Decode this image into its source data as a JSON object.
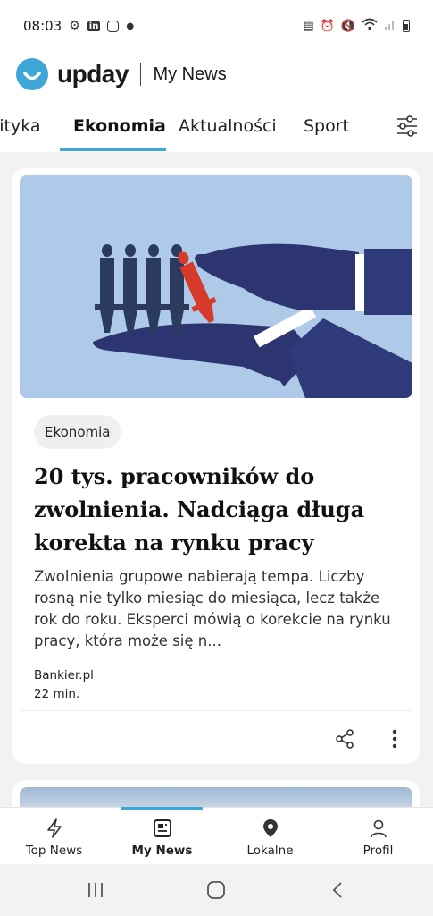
{
  "status_bar": {
    "time": "08:03",
    "left_icons": [
      "usb-icon",
      "linkedin-icon",
      "instagram-icon",
      "dot-icon"
    ],
    "right_icons": [
      "nfc-icon",
      "alarm-icon",
      "mute-icon",
      "wifi-icon",
      "signal-icon",
      "battery-icon"
    ]
  },
  "header": {
    "brand": "upday",
    "section": "My News",
    "accent_color": "#3fa6d8"
  },
  "tabs": {
    "items": [
      {
        "label": "lityka"
      },
      {
        "label": "Ekonomia",
        "active": true
      },
      {
        "label": "Aktualności"
      },
      {
        "label": "Sport"
      }
    ]
  },
  "article": {
    "category": "Ekonomia",
    "title": "20 tys. pracowników do zwolnienia. Nadciąga długa korekta na rynku pracy",
    "excerpt": "Zwolnienia grupowe nabierają tempa. Liczby rosną nie tylko miesiąc do miesiąca, lecz także rok do roku. Eksperci mówią o korekcie na rynku pracy, która może się n...",
    "source": "Bankier.pl",
    "time_ago": "22 min."
  },
  "bottom_nav": {
    "items": [
      {
        "label": "Top News",
        "icon": "lightning-icon"
      },
      {
        "label": "My News",
        "icon": "newspaper-icon",
        "active": true
      },
      {
        "label": "Lokalne",
        "icon": "location-pin-icon"
      },
      {
        "label": "Profil",
        "icon": "person-icon"
      }
    ]
  },
  "system_nav": {
    "buttons": [
      "recents-icon",
      "home-icon",
      "back-icon"
    ]
  }
}
